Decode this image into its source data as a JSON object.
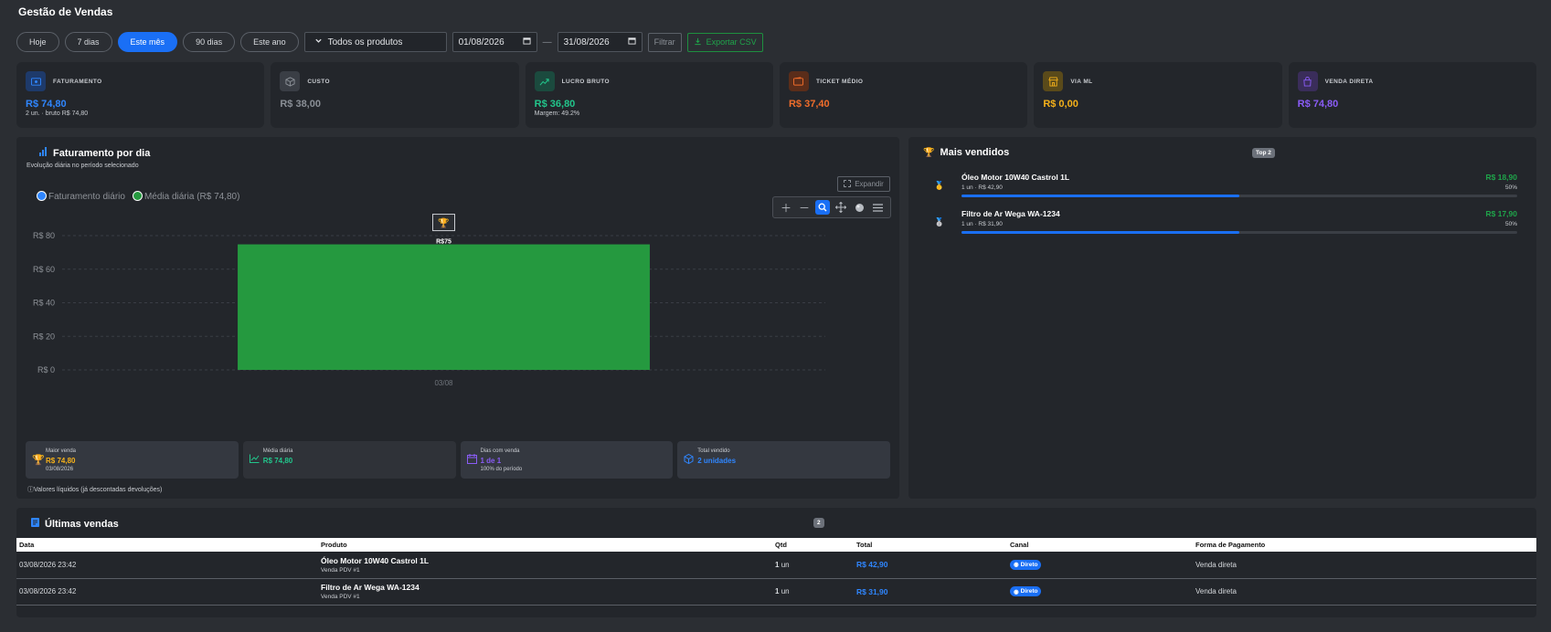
{
  "page_title": "Gestão de Vendas",
  "filters": {
    "pills": [
      "Hoje",
      "7 dias",
      "Este mês",
      "90 dias",
      "Este ano"
    ],
    "active": "Este mês",
    "product_select": "Todos os produtos",
    "date_from": "01/08/2026",
    "date_to": "31/08/2026",
    "separator": "—",
    "filter_label": "Filtrar",
    "export_label": "Exportar CSV"
  },
  "kpis": [
    {
      "label": "Faturamento",
      "value": "R$ 74,80",
      "sub": "2 un. · bruto R$ 74,80",
      "color": "#2f86ff",
      "icon": "cash-icon"
    },
    {
      "label": "Custo",
      "value": "R$ 38,00",
      "sub": "",
      "color": "#8a8f96",
      "icon": "box-icon"
    },
    {
      "label": "Lucro bruto",
      "value": "R$ 36,80",
      "sub": "Margem: 49.2%",
      "color": "#22c58b",
      "icon": "trend-icon"
    },
    {
      "label": "Ticket médio",
      "value": "R$ 37,40",
      "sub": "",
      "color": "#f06d2b",
      "icon": "wallet-icon"
    },
    {
      "label": "Via ML",
      "value": "R$ 0,00",
      "sub": "",
      "color": "#f5b11a",
      "icon": "store-icon"
    },
    {
      "label": "Venda direta",
      "value": "R$ 74,80",
      "sub": "",
      "color": "#8a5cf6",
      "icon": "bag-icon"
    }
  ],
  "chart_panel": {
    "title": "Faturamento por dia",
    "subtitle": "Evolução diária no período selecionado",
    "expand_label": "Expandir",
    "footnote": "Valores líquidos (já descontadas devoluções)",
    "stats": [
      {
        "label": "Maior venda",
        "value": "R$ 74,80",
        "sub": "03/08/2026",
        "color": "#f5b11a",
        "icon": "trophy-icon"
      },
      {
        "label": "Média diária",
        "value": "R$ 74,80",
        "sub": "",
        "color": "#22c58b",
        "icon": "chart-line-icon"
      },
      {
        "label": "Dias com venda",
        "value": "1 de 1",
        "sub": "100% do período",
        "color": "#8a5cf6",
        "icon": "calendar-icon"
      },
      {
        "label": "Total vendido",
        "value": "2 unidades",
        "sub": "",
        "color": "#2f86ff",
        "icon": "cube-icon"
      }
    ]
  },
  "chart_data": {
    "type": "bar",
    "categories": [
      "03/08"
    ],
    "series": [
      {
        "name": "Faturamento diário",
        "values": [
          74.8
        ],
        "color": "#2f86ff"
      },
      {
        "name": "Média diária (R$ 74,80)",
        "values": [
          74.8
        ],
        "color": "#25993f"
      }
    ],
    "ylim": [
      0,
      80
    ],
    "yticks": [
      "R$ 0",
      "R$ 20",
      "R$ 40",
      "R$ 60",
      "R$ 80"
    ],
    "ytick_values": [
      0,
      20,
      40,
      60,
      80
    ],
    "bar_label": "R$75",
    "grid": true,
    "legend": "top-left"
  },
  "top_panel": {
    "title": "Mais vendidos",
    "badge": "Top 2",
    "items": [
      {
        "name": "Óleo Motor 10W40 Castrol 1L",
        "detail": "1 un · R$ 42,90",
        "value": "R$ 18,90",
        "percent": "50%",
        "share": 0.5,
        "medal": "gold-medal-icon"
      },
      {
        "name": "Filtro de Ar Wega WA-1234",
        "detail": "1 un · R$ 31,90",
        "value": "R$ 17,90",
        "percent": "50%",
        "share": 0.5,
        "medal": "silver-medal-icon"
      }
    ]
  },
  "sales_panel": {
    "title": "Últimas vendas",
    "badge": "2",
    "columns": [
      "Data",
      "Produto",
      "Qtd",
      "Total",
      "Canal",
      "Forma de Pagamento"
    ],
    "rows": [
      {
        "date": "03/08/2026 23:42",
        "product": "Óleo Motor 10W40 Castrol 1L",
        "product_sub": "Venda PDV #1",
        "qty": "1",
        "unit": "un",
        "total": "R$ 42,90",
        "channel": "Direto",
        "payment": "Venda direta"
      },
      {
        "date": "03/08/2026 23:42",
        "product": "Filtro de Ar Wega WA-1234",
        "product_sub": "Venda PDV #1",
        "qty": "1",
        "unit": "un",
        "total": "R$ 31,90",
        "channel": "Direto",
        "payment": "Venda direta"
      }
    ]
  }
}
